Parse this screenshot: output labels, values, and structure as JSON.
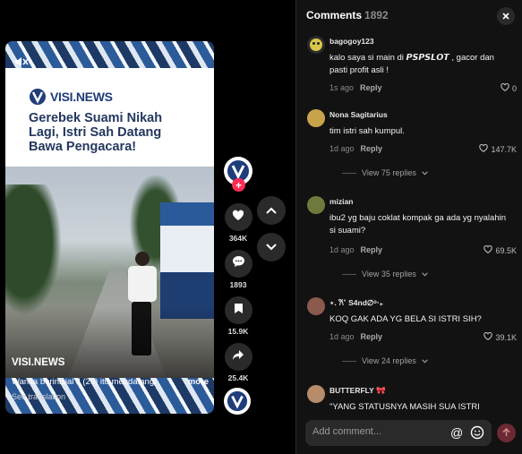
{
  "video": {
    "brand": "VISI.NEWS",
    "headline": "Gerebek Suami Nikah Lagi, Istri Sah Datang Bawa Pengacara!",
    "username": "VISI.NEWS",
    "description": "Wanita berinisial J (29) itu mendatangi",
    "more_label": "more",
    "translate_label": "See translation"
  },
  "actions": {
    "likes": "364K",
    "comments": "1893",
    "saves": "15.9K",
    "shares": "25.4K"
  },
  "comments_panel": {
    "title": "Comments",
    "count": "1892",
    "reply_label": "Reply",
    "input_placeholder": "Add comment...",
    "items": [
      {
        "username": "bagogoy123",
        "text": "kalo saya si main di 𝙋𝙎𝙋𝙎𝙇𝙊𝙏 , gacor dan pasti profit asli !",
        "time": "1s ago",
        "likes": "0",
        "avatar_color": "#2b2b2b"
      },
      {
        "username": "Nona Sagitarius",
        "text": "tim istri sah kumpul.",
        "time": "1d ago",
        "likes": "147.7K",
        "replies": "View 75 replies",
        "avatar_color": "#c9a34a"
      },
      {
        "username": "mizian",
        "text": "ibu2 yg baju coklat kompak ga ada yg nyalahin si suami?",
        "time": "1d ago",
        "likes": "69.5K",
        "replies": "View 35 replies",
        "avatar_color": "#6d7a3c"
      },
      {
        "username": "⋆. 𐙚˚ S4nd∅ᵒ‧₊",
        "text": "KOQ GAK ADA YG BELA SI ISTRI SIH?",
        "time": "1d ago",
        "likes": "39.1K",
        "replies": "View 24 replies",
        "avatar_color": "#8a5a4c"
      },
      {
        "username": "BUTTERFLY 🎀",
        "text": "\"YANG STATUSNYA MASIH SUA ISTRI",
        "avatar_color": "#b78c6a"
      }
    ]
  }
}
